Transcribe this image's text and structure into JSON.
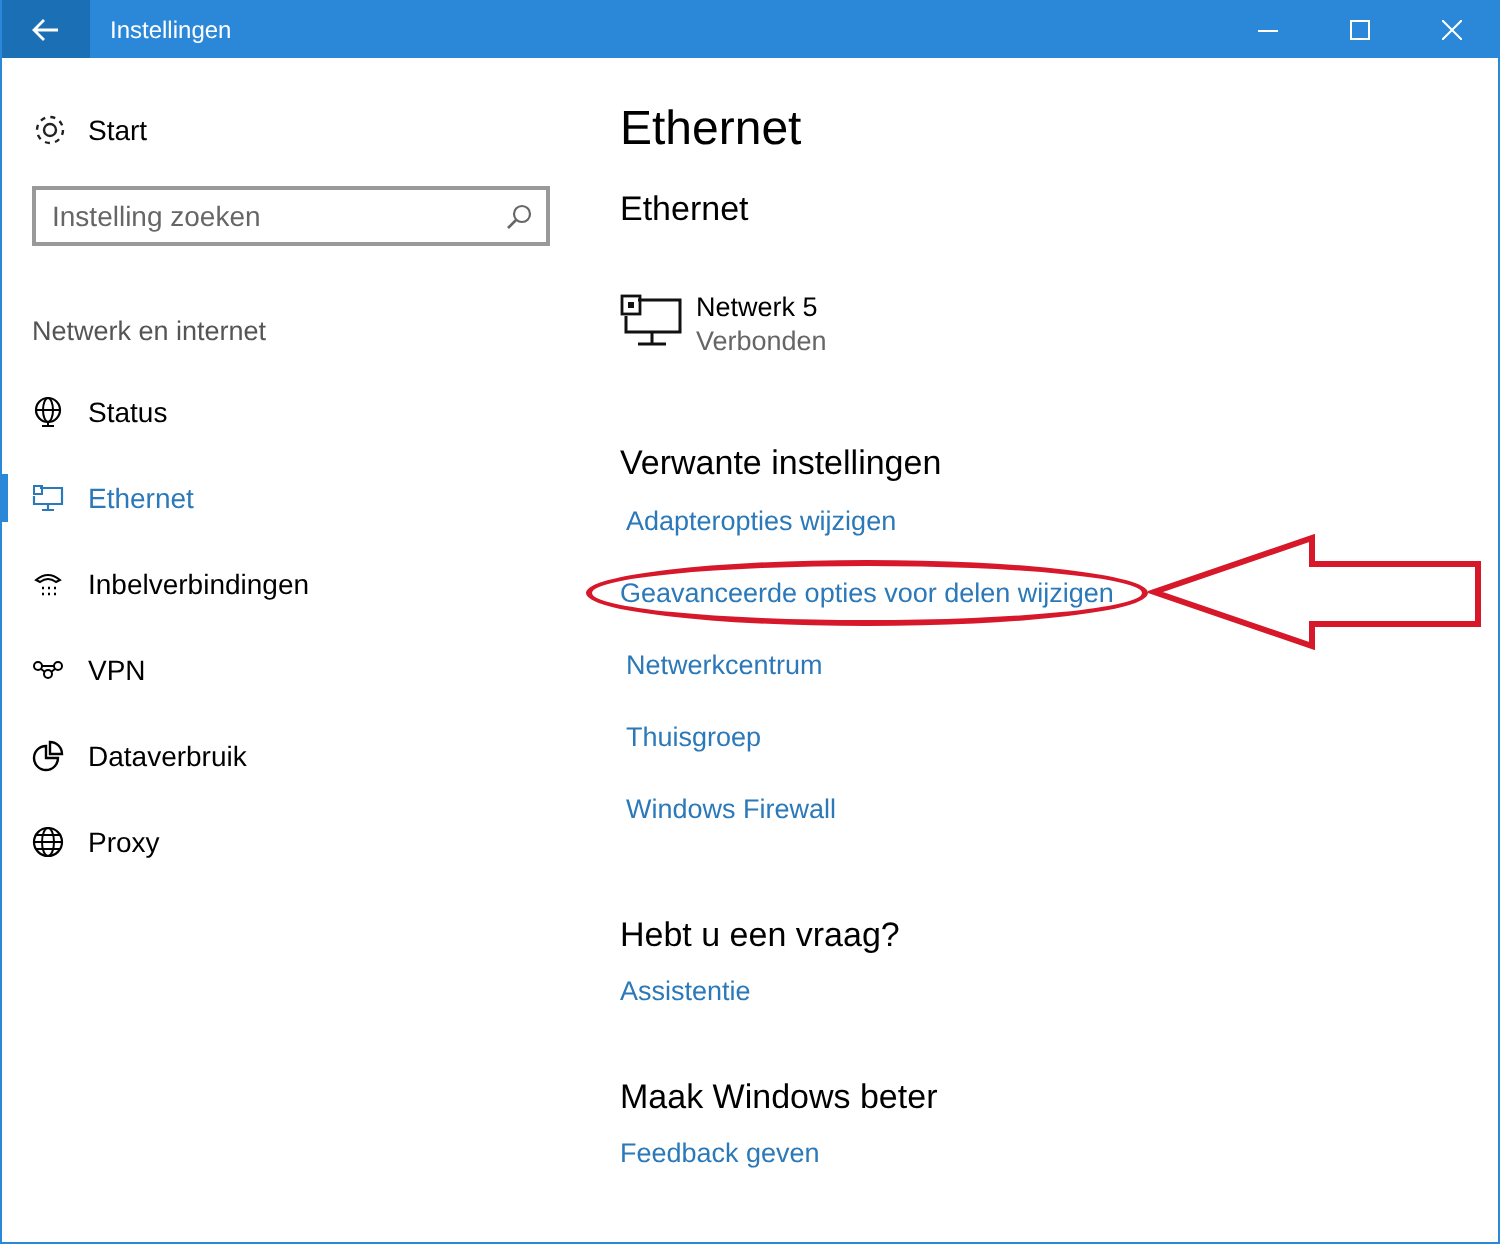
{
  "window": {
    "title": "Instellingen"
  },
  "sidebar": {
    "home": "Start",
    "search": {
      "placeholder": "Instelling zoeken"
    },
    "section": "Netwerk en internet",
    "items": [
      {
        "label": "Status",
        "selected": false
      },
      {
        "label": "Ethernet",
        "selected": true
      },
      {
        "label": "Inbelverbindingen",
        "selected": false
      },
      {
        "label": "VPN",
        "selected": false
      },
      {
        "label": "Dataverbruik",
        "selected": false
      },
      {
        "label": "Proxy",
        "selected": false
      }
    ]
  },
  "content": {
    "title": "Ethernet",
    "subtitle": "Ethernet",
    "network": {
      "name": "Netwerk  5",
      "status": "Verbonden"
    },
    "related": {
      "heading": "Verwante instellingen",
      "links": [
        {
          "label": "Adapteropties wijzigen",
          "highlighted": false
        },
        {
          "label": "Geavanceerde opties voor delen wijzigen",
          "highlighted": true
        },
        {
          "label": "Netwerkcentrum",
          "highlighted": false
        },
        {
          "label": "Thuisgroep",
          "highlighted": false
        },
        {
          "label": "Windows Firewall",
          "highlighted": false
        }
      ]
    },
    "question": {
      "heading": "Hebt u een vraag?",
      "link": "Assistentie"
    },
    "feedback": {
      "heading": "Maak Windows beter",
      "link": "Feedback geven"
    }
  }
}
